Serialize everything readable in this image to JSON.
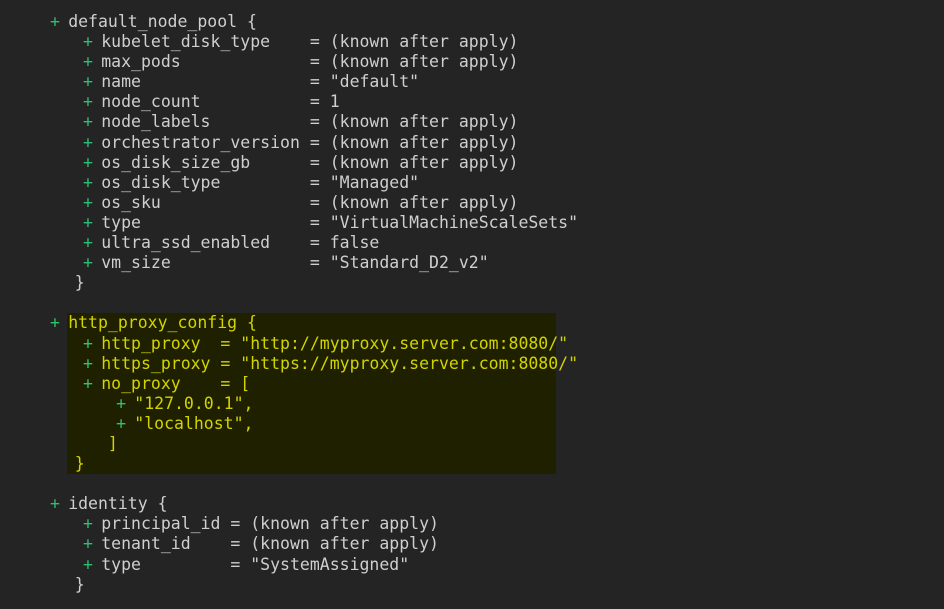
{
  "terminal": {
    "background_color": "#242424",
    "default_text_color": "#cfcfcf",
    "add_marker_color": "#2fbd74",
    "highlight_background_color": "#1f2000",
    "highlight_text_color": "#d2d400",
    "font_size_px": 16.5,
    "line_height_px": 20.1
  },
  "blocks": [
    {
      "id": "default_node_pool",
      "highlighted": false,
      "lines": [
        {
          "marker": "+",
          "marker_indent": 1,
          "text": "default_node_pool {"
        },
        {
          "marker": "+",
          "marker_indent": 5,
          "text": "kubelet_disk_type    = (known after apply)"
        },
        {
          "marker": "+",
          "marker_indent": 5,
          "text": "max_pods             = (known after apply)"
        },
        {
          "marker": "+",
          "marker_indent": 5,
          "text": "name                 = \"default\""
        },
        {
          "marker": "+",
          "marker_indent": 5,
          "text": "node_count           = 1"
        },
        {
          "marker": "+",
          "marker_indent": 5,
          "text": "node_labels          = (known after apply)"
        },
        {
          "marker": "+",
          "marker_indent": 5,
          "text": "orchestrator_version = (known after apply)"
        },
        {
          "marker": "+",
          "marker_indent": 5,
          "text": "os_disk_size_gb      = (known after apply)"
        },
        {
          "marker": "+",
          "marker_indent": 5,
          "text": "os_disk_type         = \"Managed\""
        },
        {
          "marker": "+",
          "marker_indent": 5,
          "text": "os_sku               = (known after apply)"
        },
        {
          "marker": "+",
          "marker_indent": 5,
          "text": "type                 = \"VirtualMachineScaleSets\""
        },
        {
          "marker": "+",
          "marker_indent": 5,
          "text": "ultra_ssd_enabled    = false"
        },
        {
          "marker": "+",
          "marker_indent": 5,
          "text": "vm_size              = \"Standard_D2_v2\""
        },
        {
          "marker": "",
          "marker_indent": 3,
          "text": "}"
        }
      ]
    },
    {
      "id": "blank-1",
      "highlighted": false,
      "lines": [
        {
          "marker": "",
          "marker_indent": 0,
          "text": ""
        }
      ]
    },
    {
      "id": "http_proxy_config",
      "highlighted": true,
      "lines": [
        {
          "marker": "+",
          "marker_indent": 1,
          "text": "http_proxy_config {"
        },
        {
          "marker": "+",
          "marker_indent": 5,
          "text": "http_proxy  = \"http://myproxy.server.com:8080/\""
        },
        {
          "marker": "+",
          "marker_indent": 5,
          "text": "https_proxy = \"https://myproxy.server.com:8080/\""
        },
        {
          "marker": "+",
          "marker_indent": 5,
          "text": "no_proxy    = ["
        },
        {
          "marker": "+",
          "marker_indent": 9,
          "text": "\"127.0.0.1\","
        },
        {
          "marker": "+",
          "marker_indent": 9,
          "text": "\"localhost\","
        },
        {
          "marker": "",
          "marker_indent": 7,
          "text": "]"
        },
        {
          "marker": "",
          "marker_indent": 3,
          "text": "}"
        }
      ]
    },
    {
      "id": "blank-2",
      "highlighted": false,
      "lines": [
        {
          "marker": "",
          "marker_indent": 0,
          "text": ""
        }
      ]
    },
    {
      "id": "identity",
      "highlighted": false,
      "lines": [
        {
          "marker": "+",
          "marker_indent": 1,
          "text": "identity {"
        },
        {
          "marker": "+",
          "marker_indent": 5,
          "text": "principal_id = (known after apply)"
        },
        {
          "marker": "+",
          "marker_indent": 5,
          "text": "tenant_id    = (known after apply)"
        },
        {
          "marker": "+",
          "marker_indent": 5,
          "text": "type         = \"SystemAssigned\""
        },
        {
          "marker": "",
          "marker_indent": 3,
          "text": "}"
        }
      ]
    }
  ]
}
